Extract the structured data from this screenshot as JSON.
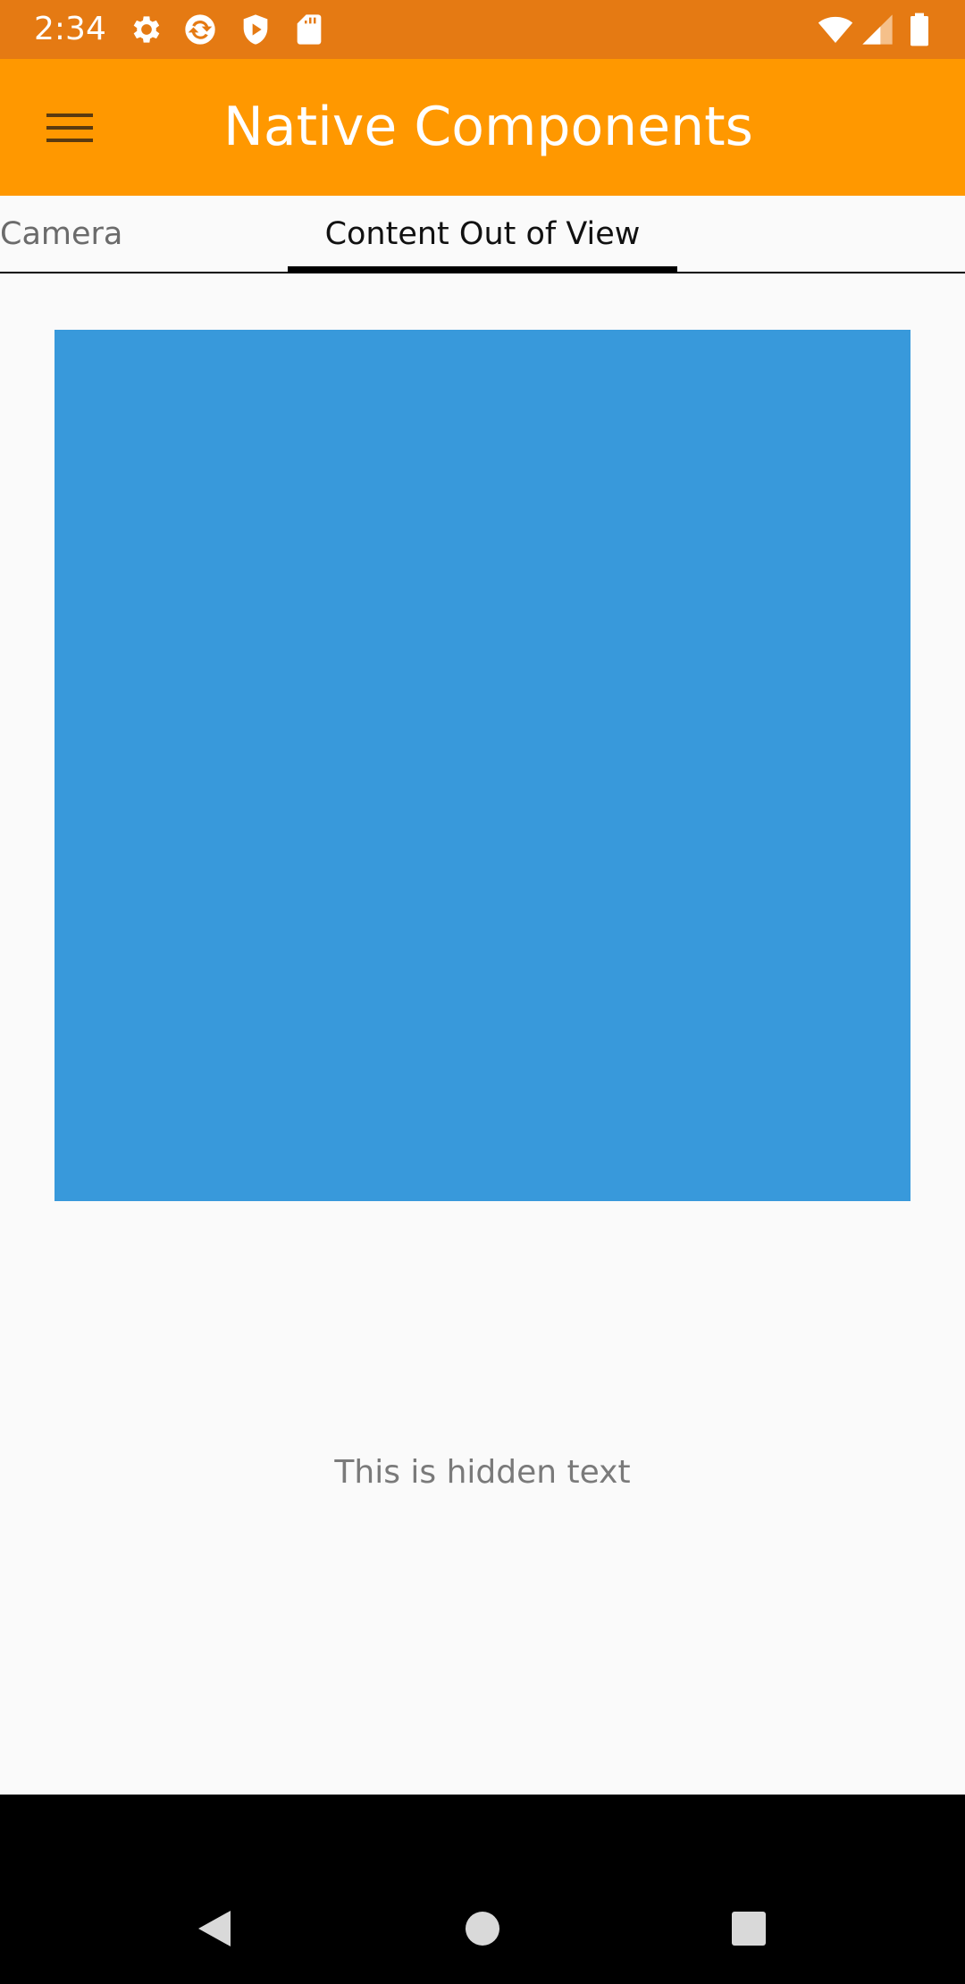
{
  "status_bar": {
    "time": "2:34",
    "icons": [
      "gear-icon",
      "sync-icon",
      "shield-play-icon",
      "sd-card-icon",
      "wifi-icon",
      "signal-icon",
      "battery-icon"
    ],
    "background": "#e57a13"
  },
  "app_bar": {
    "title": "Native Components",
    "menu_icon": "hamburger-menu-icon",
    "background": "#ff9800"
  },
  "tabs": [
    {
      "label": "Camera",
      "selected": false
    },
    {
      "label": "Content Out of View",
      "selected": true
    }
  ],
  "content": {
    "box_color": "#3899db",
    "hidden_text": "This is hidden text"
  },
  "nav_bar": {
    "buttons": [
      "back-icon",
      "home-icon",
      "recents-icon"
    ]
  }
}
